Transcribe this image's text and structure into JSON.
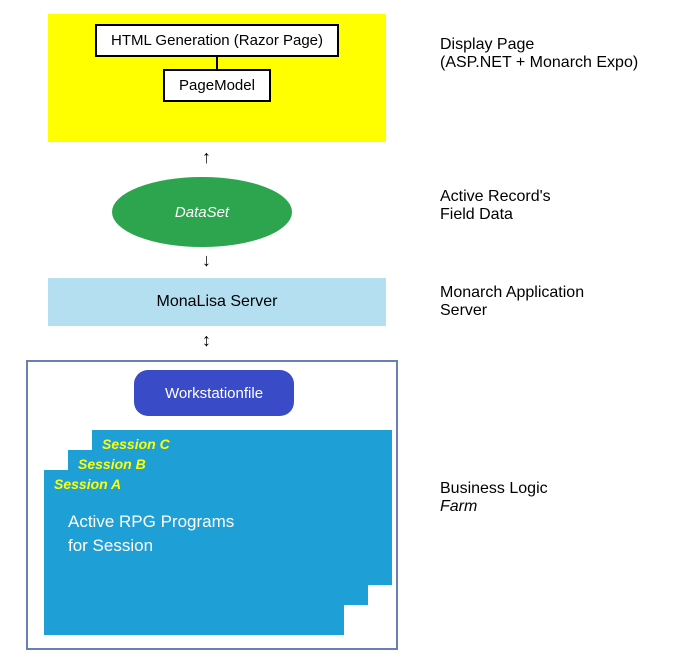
{
  "diagram": {
    "yellow_box": {
      "inner1": "HTML Generation (Razor Page)",
      "inner2": "PageModel"
    },
    "ellipse": "DataSet",
    "monalisa": "MonaLisa Server",
    "pill": "Workstationfile",
    "sessions": {
      "c": "Session C",
      "b": "Session B",
      "a": "Session A",
      "body_line1": "Active RPG Programs",
      "body_line2": "for Session"
    }
  },
  "labels": {
    "l1a": "Display Page",
    "l1b": "(ASP.NET + Monarch Expo)",
    "l2a": "Active Record's",
    "l2b": "Field Data",
    "l3a": "Monarch Application",
    "l3b": "Server",
    "l4a": "Business Logic",
    "l4b": "Farm"
  }
}
